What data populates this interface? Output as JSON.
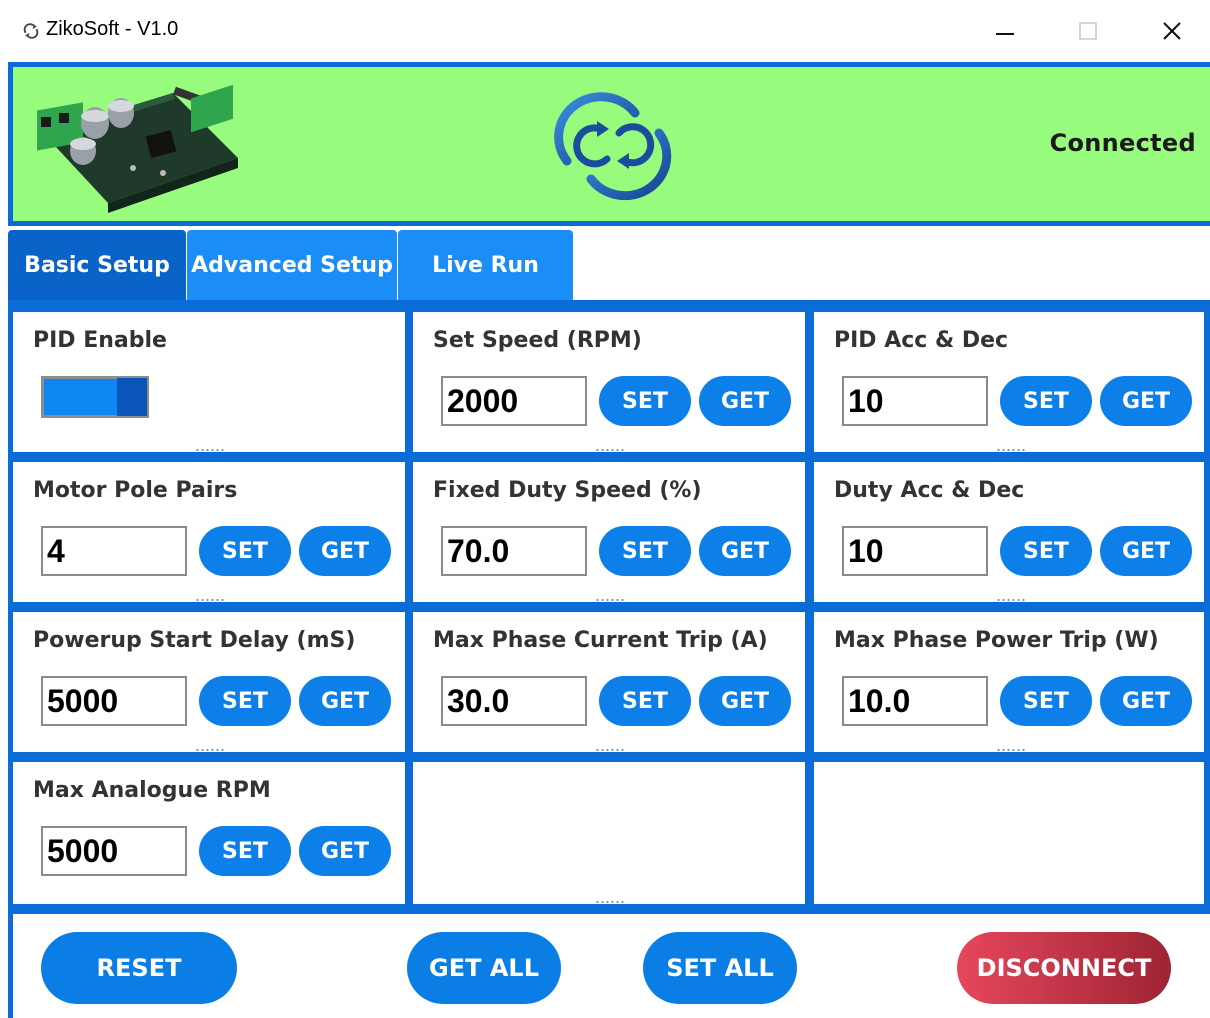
{
  "window": {
    "title": "ZikoSoft - V1.0",
    "minimize_label": "—",
    "maximize_label": "☐",
    "close_label": "✕"
  },
  "header": {
    "status": "Connected",
    "bg_color": "#97fb7e",
    "border_color": "#0a6cd6",
    "image": "motor-controller-board",
    "logo": "sync-logo-icon"
  },
  "tabs": [
    {
      "label": "Basic Setup",
      "active": true
    },
    {
      "label": "Advanced Setup",
      "active": false
    },
    {
      "label": "Live Run",
      "active": false
    }
  ],
  "panels": {
    "pid_enable": {
      "title": "PID Enable",
      "enabled": true
    },
    "set_speed": {
      "title": "Set Speed (RPM)",
      "value": "2000"
    },
    "pid_acc_dec": {
      "title": "PID Acc & Dec",
      "value": "10"
    },
    "motor_pole_pairs": {
      "title": "Motor Pole Pairs",
      "value": "4"
    },
    "fixed_duty_speed": {
      "title": "Fixed Duty Speed (%)",
      "value": "70.0"
    },
    "duty_acc_dec": {
      "title": "Duty Acc & Dec",
      "value": "10"
    },
    "powerup_start_delay": {
      "title": "Powerup Start Delay (mS)",
      "value": "5000"
    },
    "max_phase_current_trip": {
      "title": "Max Phase Current Trip (A)",
      "value": "30.0"
    },
    "max_phase_power_trip": {
      "title": "Max Phase Power Trip (W)",
      "value": "10.0"
    },
    "max_analogue_rpm": {
      "title": "Max Analogue RPM",
      "value": "5000"
    }
  },
  "buttons": {
    "set": "SET",
    "get": "GET",
    "reset": "RESET",
    "get_all": "GET ALL",
    "set_all": "SET ALL",
    "disconnect": "DISCONNECT"
  },
  "colors": {
    "primary_blue": "#0b7ee6",
    "tab_blue": "#1b8df7",
    "tab_active": "#0a63c8",
    "disconnect_red": "#e6475d"
  }
}
